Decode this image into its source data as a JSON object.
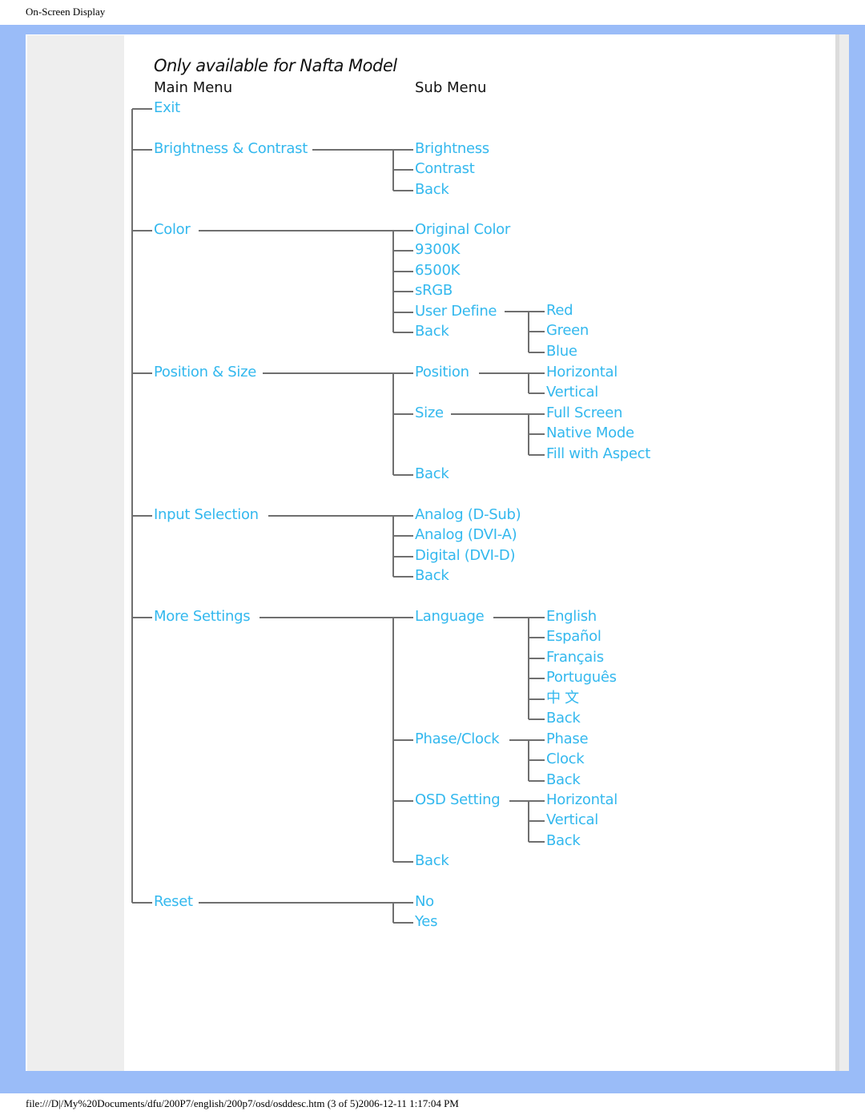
{
  "page": {
    "header": "On-Screen Display",
    "footer": "file:///D|/My%20Documents/dfu/200P7/english/200p7/osd/osddesc.htm (3 of 5)2006-12-11 1:17:04 PM"
  },
  "diagram": {
    "title": "Only available for Nafta Model",
    "main_menu_header": "Main Menu",
    "sub_menu_header": "Sub Menu",
    "colors": {
      "item": "#33b8ee",
      "line": "#6f6f6f",
      "frame": "#9abcf8"
    },
    "main": [
      {
        "label": "Exit"
      },
      {
        "label": "Brightness & Contrast",
        "sub": [
          "Brightness",
          "Contrast",
          "Back"
        ]
      },
      {
        "label": "Color",
        "sub": [
          "Original Color",
          "9300K",
          "6500K",
          "sRGB",
          "User Define",
          "Back"
        ],
        "user_define": [
          "Red",
          "Green",
          "Blue"
        ]
      },
      {
        "label": "Position & Size",
        "sub": [
          "Position",
          "Size",
          "Back"
        ],
        "position": [
          "Horizontal",
          "Vertical"
        ],
        "size": [
          "Full Screen",
          "Native Mode",
          "Fill with Aspect"
        ]
      },
      {
        "label": "Input Selection",
        "sub": [
          "Analog (D-Sub)",
          "Analog (DVI-A)",
          "Digital (DVI-D)",
          "Back"
        ]
      },
      {
        "label": "More Settings",
        "sub": [
          "Language",
          "Phase/Clock",
          "OSD Setting",
          "Back"
        ],
        "language": [
          "English",
          "Español",
          "Français",
          "Português",
          "中 文",
          "Back"
        ],
        "phase_clock": [
          "Phase",
          "Clock",
          "Back"
        ],
        "osd_setting": [
          "Horizontal",
          "Vertical",
          "Back"
        ]
      },
      {
        "label": "Reset",
        "sub": [
          "No",
          "Yes"
        ]
      }
    ]
  }
}
